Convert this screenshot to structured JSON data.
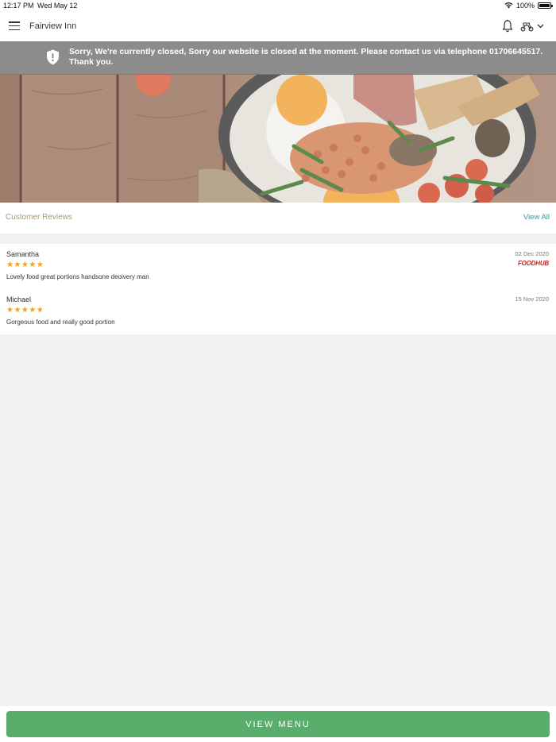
{
  "status_bar": {
    "time": "12:17 PM",
    "date": "Wed May 12",
    "battery": "100%",
    "icons": [
      "wifi-icon",
      "battery-icon"
    ]
  },
  "header": {
    "title": "Fairview Inn",
    "icons": [
      "menu-icon",
      "bell-icon",
      "delivery-scooter-icon",
      "chevron-down-icon"
    ]
  },
  "banner": {
    "message": "Sorry, We're currently closed, Sorry our website is closed at the moment. Please contact us via telephone 01706645517. Thank you.",
    "icon": "shield-alert-icon"
  },
  "hero": {
    "image": "breakfast-pan-photo"
  },
  "reviews": {
    "title": "Customer Reviews",
    "view_all": "View All",
    "items": [
      {
        "name": "Samantha",
        "date": "02 Dec 2020",
        "stars": "★★★★★",
        "rating": 5,
        "text": "Lovely food great portions handsone deoivery man",
        "source": "FOODHUB"
      },
      {
        "name": "Michael",
        "date": "15 Nov 2020",
        "stars": "★★★★★",
        "rating": 5,
        "text": "Gorgeous food and really good portion",
        "source": ""
      }
    ]
  },
  "footer": {
    "view_menu": "VIEW MENU"
  },
  "colors": {
    "accent_green": "#5aae6c",
    "link_teal": "#2a9aa8",
    "star_orange": "#f0a31b",
    "banner_grey": "#8c8c8c",
    "reviews_title": "#a89a74",
    "foodhub_red": "#d4201f"
  }
}
